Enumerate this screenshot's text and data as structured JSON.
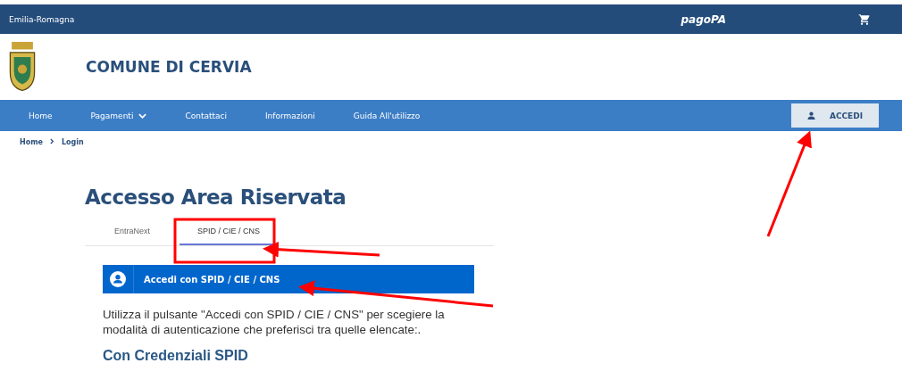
{
  "top_bar": {
    "region": "Emilia-Romagna",
    "logo_text": "pagoPA"
  },
  "header": {
    "title": "COMUNE DI CERVIA"
  },
  "nav": {
    "items": [
      {
        "label": "Home",
        "dropdown": false
      },
      {
        "label": "Pagamenti",
        "dropdown": true
      },
      {
        "label": "Contattaci",
        "dropdown": false
      },
      {
        "label": "Informazioni",
        "dropdown": false
      },
      {
        "label": "Guida All'utilizzo",
        "dropdown": false
      }
    ],
    "login_button": "ACCEDI"
  },
  "breadcrumb": [
    "Home",
    "Login"
  ],
  "page_title": "Accesso Area Riservata",
  "tabs": [
    {
      "label": "EntraNext",
      "selected": false
    },
    {
      "label": "SPID / CIE / CNS",
      "selected": true
    }
  ],
  "login_bar": {
    "label": "Accedi con SPID / CIE / CNS"
  },
  "description": "Utilizza il pulsante \"Accedi con SPID / CIE / CNS\" per scegiere la modalità di autenticazione che preferisci tra quelle elencate:.",
  "section_heading": "Con Credenziali SPID"
}
